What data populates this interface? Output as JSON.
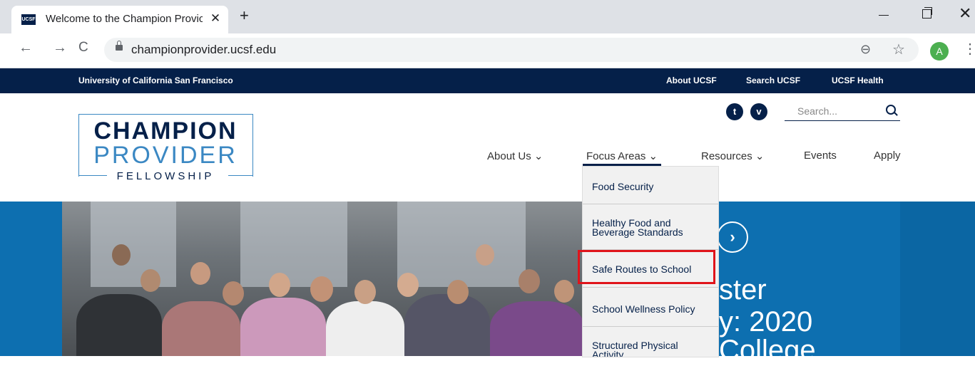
{
  "browser": {
    "tab_title": "Welcome to the Champion Provic",
    "favicon_text": "UCSF",
    "tab_close": "✕",
    "new_tab": "+",
    "url": "championprovider.ucsf.edu",
    "back": "←",
    "forward": "→",
    "reload": "C",
    "zoom": "⊖",
    "star": "☆",
    "avatar_letter": "A",
    "menu": "⋮",
    "window_close": "✕"
  },
  "ucsf_bar": {
    "name": "University of California San Francisco",
    "links": [
      "About UCSF",
      "Search UCSF",
      "UCSF Health"
    ]
  },
  "logo": {
    "line1": "CHAMPION",
    "line2": "PROVIDER",
    "line3": "FELLOWSHIP"
  },
  "social": {
    "twitter": "t",
    "vimeo": "v"
  },
  "search": {
    "placeholder": "Search..."
  },
  "nav": {
    "about": "About Us ⌄",
    "focus": "Focus Areas ⌄",
    "resources": "Resources ⌄",
    "events": "Events",
    "apply": "Apply"
  },
  "dropdown": {
    "items": [
      "Food Security",
      "Healthy Food and",
      "Beverage Standards",
      "Safe Routes to School",
      "School Wellness Policy",
      "Structured Physical",
      "Activity"
    ]
  },
  "hero": {
    "arrow": "›",
    "line1": "ster",
    "line2": "y: 2020",
    "line3": "College"
  },
  "colors": {
    "navy": "#052049",
    "hero_blue": "#0d6fb0",
    "logo_blue": "#3b88c3",
    "highlight_red": "#e0141b"
  }
}
